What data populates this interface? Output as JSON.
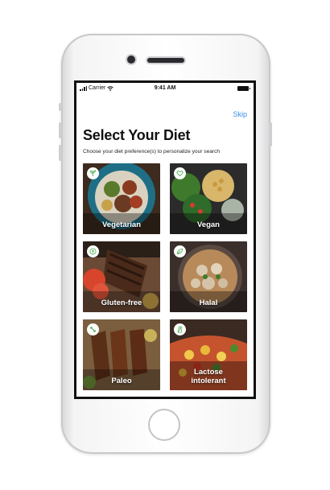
{
  "status_bar": {
    "carrier": "Carrier",
    "time": "9:41 AM"
  },
  "header": {
    "skip_label": "Skip",
    "title": "Select Your Diet",
    "subtitle": "Choose your diet preference(s) to personalize your search"
  },
  "diets": [
    {
      "label": "Vegetarian",
      "icon": "sprout-icon"
    },
    {
      "label": "Vegan",
      "icon": "heart-leaf-icon"
    },
    {
      "label": "Gluten-free",
      "icon": "no-wheat-icon"
    },
    {
      "label": "Halal",
      "icon": "leaf-icon"
    },
    {
      "label": "Paleo",
      "icon": "bone-icon"
    },
    {
      "label": "Lactose intolerant",
      "icon": "milk-bottle-icon"
    }
  ],
  "colors": {
    "accent": "#3b8ee6",
    "badge_icon": "#4caf50"
  }
}
